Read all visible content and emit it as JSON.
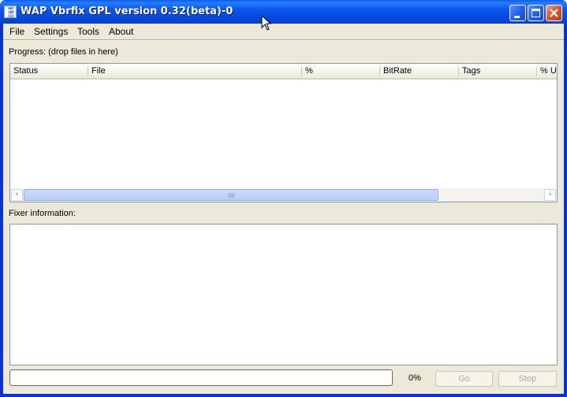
{
  "window": {
    "title": "WAP Vbrfix GPL version 0.32(beta)-0",
    "icon_text": [
      "WAP",
      "VBR",
      "FIX"
    ],
    "controls": [
      "minimize-icon",
      "maximize-icon",
      "close-icon"
    ]
  },
  "menu": {
    "items": [
      "File",
      "Settings",
      "Tools",
      "About"
    ]
  },
  "progress_section": {
    "label": "Progress: (drop files in here)",
    "columns": [
      "Status",
      "File",
      "%",
      "BitRate",
      "Tags",
      "% U"
    ]
  },
  "fixer_section": {
    "label": "Fixer information:"
  },
  "footer": {
    "progress_percent": 0,
    "percent_label": "0%",
    "go_label": "Go",
    "stop_label": "Stop"
  },
  "colors": {
    "title_bar": "#0a5cf0",
    "client_bg": "#ece9d8",
    "disabled_text": "#aca899"
  }
}
